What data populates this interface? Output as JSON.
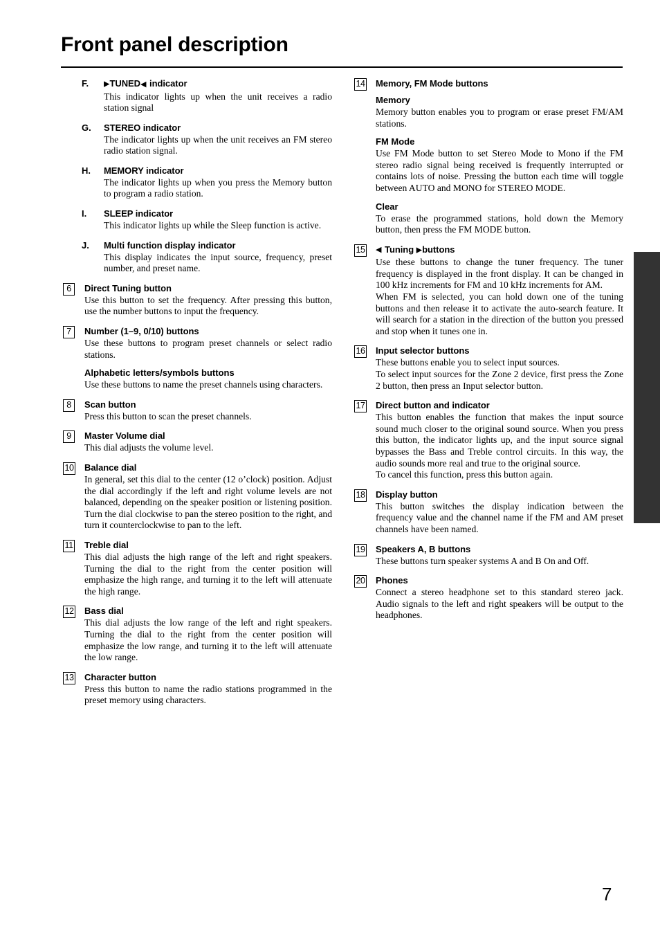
{
  "page": {
    "title": "Front panel description",
    "number": "7"
  },
  "left_column": {
    "lettered_items": [
      {
        "marker": "F.",
        "heading_pre_icon": "",
        "heading": "TUNED",
        "heading_suffix": "indicator",
        "icon_left": "triangle-right",
        "icon_right": "triangle-left",
        "body": "This indicator lights up when the unit receives a radio station signal"
      },
      {
        "marker": "G.",
        "heading": "STEREO indicator",
        "body": "The indicator lights up when the unit receives an FM stereo radio station signal."
      },
      {
        "marker": "H.",
        "heading": "MEMORY indicator",
        "body": "The indicator lights up when you press the Memory button to program a radio station."
      },
      {
        "marker": "I.",
        "heading": "SLEEP indicator",
        "body": "This indicator lights up while the Sleep function is active."
      },
      {
        "marker": "J.",
        "heading": "Multi function display indicator",
        "body": "This display indicates the input source, frequency, preset number, and preset name."
      }
    ],
    "numbered_items": [
      {
        "number": "6",
        "heading": "Direct Tuning button",
        "body": "Use this button to set the frequency. After pressing this button, use the number buttons to input the frequency."
      },
      {
        "number": "7",
        "heading": "Number (1–9, 0/10) buttons",
        "body": "Use these buttons to program preset channels or select radio stations.",
        "subsections": [
          {
            "subheading": "Alphabetic letters/symbols buttons",
            "body": "Use these buttons to name the preset channels using characters."
          }
        ]
      },
      {
        "number": "8",
        "heading": "Scan button",
        "body": "Press this button to scan the preset channels."
      },
      {
        "number": "9",
        "heading": "Master Volume dial",
        "body": "This dial adjusts the volume level."
      },
      {
        "number": "10",
        "heading": "Balance dial",
        "body": "In general, set this dial to the center (12 o’clock) position. Adjust the dial accordingly if the left and right volume levels are not balanced, depending on the speaker position or listening position. Turn the dial clockwise to pan the stereo position to the right, and turn it counterclockwise to pan to the left."
      },
      {
        "number": "11",
        "heading": "Treble dial",
        "body": "This dial adjusts the high range of the left and right speakers. Turning the dial to the right from the center position will emphasize the high range, and turning it to the left will attenuate the high range."
      },
      {
        "number": "12",
        "heading": "Bass dial",
        "body": "This dial adjusts the low range of the left and right speakers. Turning the dial to the right from the center position will emphasize the low range, and turning it to the left will attenuate the low range."
      },
      {
        "number": "13",
        "heading": "Character button",
        "body": "Press this button to name the radio stations programmed in the preset memory using characters."
      }
    ]
  },
  "right_column": {
    "numbered_items": [
      {
        "number": "14",
        "heading": "Memory, FM Mode buttons",
        "subsections": [
          {
            "subheading": "Memory",
            "body": "Memory button enables you to program or erase preset FM/AM stations."
          },
          {
            "subheading": "FM Mode",
            "body": "Use FM Mode button to set Stereo Mode to Mono if the FM stereo radio signal being received is frequently interrupted or contains lots of noise. Pressing the button each time will toggle between AUTO and MONO for STEREO MODE."
          },
          {
            "subheading": "Clear",
            "body": "To erase the programmed stations, hold down the Memory button, then press the FM MODE button."
          }
        ]
      },
      {
        "number": "15",
        "heading_word": "Tuning",
        "heading_suffix": "buttons",
        "icon_left": "triangle-left",
        "icon_right": "triangle-right",
        "body": "Use these buttons to change the tuner frequency. The tuner frequency is displayed in the front display. It can be changed in 100 kHz increments for FM and 10 kHz increments for AM.",
        "body2": "When FM is selected, you can hold down one of the tuning buttons and then release it to activate the auto-search feature. It will search for a station in the direction of the button you pressed and stop when it tunes one in."
      },
      {
        "number": "16",
        "heading": "Input selector buttons",
        "body": "These buttons enable you to select input sources.",
        "body2": "To select input sources for the Zone 2 device, first press the Zone 2 button, then press an Input selector button."
      },
      {
        "number": "17",
        "heading": "Direct button and indicator",
        "body": "This button enables the function that makes the input source sound much closer to the original sound source. When you press this button, the indicator lights up, and the input source signal bypasses the Bass and Treble control circuits. In this way, the audio sounds more real and true to the original source.",
        "body2": "To cancel this function, press this button again."
      },
      {
        "number": "18",
        "heading": "Display button",
        "body": "This button switches the display indication between the frequency value and the channel name if the FM and AM preset channels have been named."
      },
      {
        "number": "19",
        "heading": "Speakers A, B buttons",
        "body": "These buttons turn speaker systems A and B On and Off."
      },
      {
        "number": "20",
        "heading": "Phones",
        "body": "Connect a stereo headphone set to this standard stereo jack. Audio signals to the left and right speakers will be output to the headphones."
      }
    ]
  }
}
